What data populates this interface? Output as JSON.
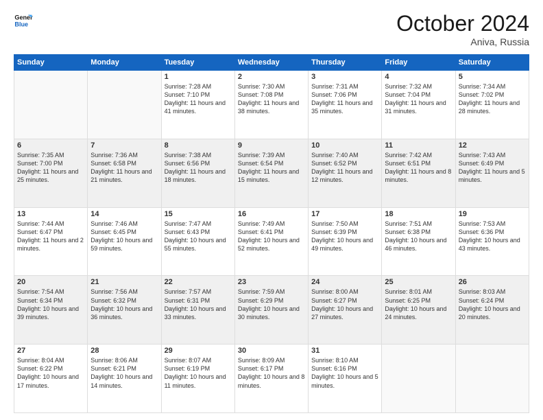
{
  "logo": {
    "line1": "General",
    "line2": "Blue"
  },
  "header": {
    "month": "October 2024",
    "location": "Aniva, Russia"
  },
  "weekdays": [
    "Sunday",
    "Monday",
    "Tuesday",
    "Wednesday",
    "Thursday",
    "Friday",
    "Saturday"
  ],
  "weeks": [
    [
      {
        "day": "",
        "info": ""
      },
      {
        "day": "",
        "info": ""
      },
      {
        "day": "1",
        "info": "Sunrise: 7:28 AM\nSunset: 7:10 PM\nDaylight: 11 hours and 41 minutes."
      },
      {
        "day": "2",
        "info": "Sunrise: 7:30 AM\nSunset: 7:08 PM\nDaylight: 11 hours and 38 minutes."
      },
      {
        "day": "3",
        "info": "Sunrise: 7:31 AM\nSunset: 7:06 PM\nDaylight: 11 hours and 35 minutes."
      },
      {
        "day": "4",
        "info": "Sunrise: 7:32 AM\nSunset: 7:04 PM\nDaylight: 11 hours and 31 minutes."
      },
      {
        "day": "5",
        "info": "Sunrise: 7:34 AM\nSunset: 7:02 PM\nDaylight: 11 hours and 28 minutes."
      }
    ],
    [
      {
        "day": "6",
        "info": "Sunrise: 7:35 AM\nSunset: 7:00 PM\nDaylight: 11 hours and 25 minutes."
      },
      {
        "day": "7",
        "info": "Sunrise: 7:36 AM\nSunset: 6:58 PM\nDaylight: 11 hours and 21 minutes."
      },
      {
        "day": "8",
        "info": "Sunrise: 7:38 AM\nSunset: 6:56 PM\nDaylight: 11 hours and 18 minutes."
      },
      {
        "day": "9",
        "info": "Sunrise: 7:39 AM\nSunset: 6:54 PM\nDaylight: 11 hours and 15 minutes."
      },
      {
        "day": "10",
        "info": "Sunrise: 7:40 AM\nSunset: 6:52 PM\nDaylight: 11 hours and 12 minutes."
      },
      {
        "day": "11",
        "info": "Sunrise: 7:42 AM\nSunset: 6:51 PM\nDaylight: 11 hours and 8 minutes."
      },
      {
        "day": "12",
        "info": "Sunrise: 7:43 AM\nSunset: 6:49 PM\nDaylight: 11 hours and 5 minutes."
      }
    ],
    [
      {
        "day": "13",
        "info": "Sunrise: 7:44 AM\nSunset: 6:47 PM\nDaylight: 11 hours and 2 minutes."
      },
      {
        "day": "14",
        "info": "Sunrise: 7:46 AM\nSunset: 6:45 PM\nDaylight: 10 hours and 59 minutes."
      },
      {
        "day": "15",
        "info": "Sunrise: 7:47 AM\nSunset: 6:43 PM\nDaylight: 10 hours and 55 minutes."
      },
      {
        "day": "16",
        "info": "Sunrise: 7:49 AM\nSunset: 6:41 PM\nDaylight: 10 hours and 52 minutes."
      },
      {
        "day": "17",
        "info": "Sunrise: 7:50 AM\nSunset: 6:39 PM\nDaylight: 10 hours and 49 minutes."
      },
      {
        "day": "18",
        "info": "Sunrise: 7:51 AM\nSunset: 6:38 PM\nDaylight: 10 hours and 46 minutes."
      },
      {
        "day": "19",
        "info": "Sunrise: 7:53 AM\nSunset: 6:36 PM\nDaylight: 10 hours and 43 minutes."
      }
    ],
    [
      {
        "day": "20",
        "info": "Sunrise: 7:54 AM\nSunset: 6:34 PM\nDaylight: 10 hours and 39 minutes."
      },
      {
        "day": "21",
        "info": "Sunrise: 7:56 AM\nSunset: 6:32 PM\nDaylight: 10 hours and 36 minutes."
      },
      {
        "day": "22",
        "info": "Sunrise: 7:57 AM\nSunset: 6:31 PM\nDaylight: 10 hours and 33 minutes."
      },
      {
        "day": "23",
        "info": "Sunrise: 7:59 AM\nSunset: 6:29 PM\nDaylight: 10 hours and 30 minutes."
      },
      {
        "day": "24",
        "info": "Sunrise: 8:00 AM\nSunset: 6:27 PM\nDaylight: 10 hours and 27 minutes."
      },
      {
        "day": "25",
        "info": "Sunrise: 8:01 AM\nSunset: 6:25 PM\nDaylight: 10 hours and 24 minutes."
      },
      {
        "day": "26",
        "info": "Sunrise: 8:03 AM\nSunset: 6:24 PM\nDaylight: 10 hours and 20 minutes."
      }
    ],
    [
      {
        "day": "27",
        "info": "Sunrise: 8:04 AM\nSunset: 6:22 PM\nDaylight: 10 hours and 17 minutes."
      },
      {
        "day": "28",
        "info": "Sunrise: 8:06 AM\nSunset: 6:21 PM\nDaylight: 10 hours and 14 minutes."
      },
      {
        "day": "29",
        "info": "Sunrise: 8:07 AM\nSunset: 6:19 PM\nDaylight: 10 hours and 11 minutes."
      },
      {
        "day": "30",
        "info": "Sunrise: 8:09 AM\nSunset: 6:17 PM\nDaylight: 10 hours and 8 minutes."
      },
      {
        "day": "31",
        "info": "Sunrise: 8:10 AM\nSunset: 6:16 PM\nDaylight: 10 hours and 5 minutes."
      },
      {
        "day": "",
        "info": ""
      },
      {
        "day": "",
        "info": ""
      }
    ]
  ]
}
